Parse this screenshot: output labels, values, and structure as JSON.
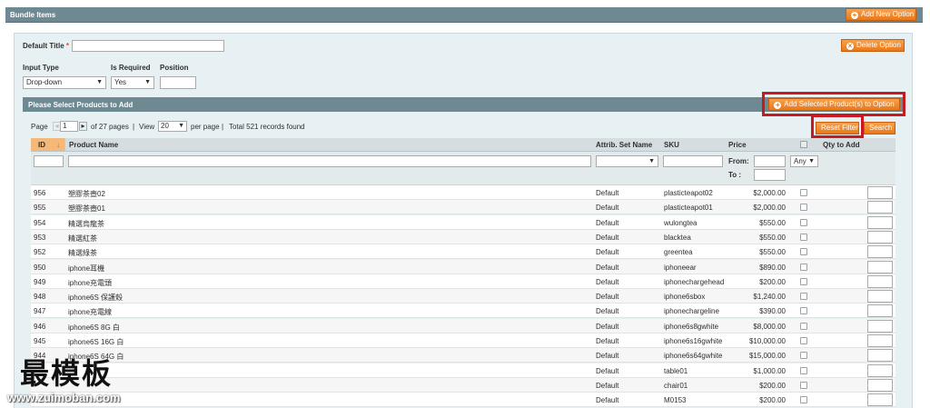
{
  "header": {
    "title": "Bundle Items",
    "add_new_option_label": "Add New Option"
  },
  "option": {
    "default_title_label": "Default Title",
    "required_mark": "*",
    "default_title_value": "",
    "delete_option_label": "Delete Option",
    "input_type_label": "Input Type",
    "input_type_value": "Drop-down",
    "is_required_label": "Is Required",
    "is_required_value": "Yes",
    "position_label": "Position",
    "position_value": ""
  },
  "grid": {
    "title": "Please Select Products to Add",
    "add_selected_label": "Add Selected Product(s) to Option",
    "reset_filter_label": "Reset Filter",
    "search_label": "Search",
    "pager": {
      "page_label": "Page",
      "page_value": "1",
      "of_pages": "of 27 pages",
      "separator": "|",
      "view_label": "View",
      "per_page_value": "20",
      "per_page_label": "per page",
      "total": "Total 521 records found"
    },
    "columns": {
      "id": "ID",
      "sort_arrow": "↓",
      "name": "Product Name",
      "attrib_set": "Attrib. Set Name",
      "sku": "SKU",
      "price": "Price",
      "qty": "Qty to Add"
    },
    "filters": {
      "price_from_label": "From:",
      "price_to_label": "To :",
      "select_any": "Any"
    },
    "rows": [
      {
        "id": "956",
        "name": "塑膠茶壺02",
        "set": "Default",
        "sku": "plasticteapot02",
        "price": "$2,000.00"
      },
      {
        "id": "955",
        "name": "塑膠茶壺01",
        "set": "Default",
        "sku": "plasticteapot01",
        "price": "$2,000.00"
      },
      {
        "id": "954",
        "name": "精選烏龍茶",
        "set": "Default",
        "sku": "wulongtea",
        "price": "$550.00"
      },
      {
        "id": "953",
        "name": "精選紅茶",
        "set": "Default",
        "sku": "blacktea",
        "price": "$550.00"
      },
      {
        "id": "952",
        "name": "精選綠茶",
        "set": "Default",
        "sku": "greentea",
        "price": "$550.00"
      },
      {
        "id": "950",
        "name": "iphone耳機",
        "set": "Default",
        "sku": "iphoneear",
        "price": "$890.00"
      },
      {
        "id": "949",
        "name": "iphone充電頭",
        "set": "Default",
        "sku": "iphonechargehead",
        "price": "$200.00"
      },
      {
        "id": "948",
        "name": "iphone6S 保護殼",
        "set": "Default",
        "sku": "iphone6sbox",
        "price": "$1,240.00"
      },
      {
        "id": "947",
        "name": "iphone充電線",
        "set": "Default",
        "sku": "iphonechargeline",
        "price": "$390.00"
      },
      {
        "id": "946",
        "name": "iphone6S 8G 白",
        "set": "Default",
        "sku": "iphone6s8gwhite",
        "price": "$8,000.00"
      },
      {
        "id": "945",
        "name": "iphone6S 16G 白",
        "set": "Default",
        "sku": "iphone6s16gwhite",
        "price": "$10,000.00"
      },
      {
        "id": "944",
        "name": "iphone6S 64G 白",
        "set": "Default",
        "sku": "iphone6s64gwhite",
        "price": "$15,000.00"
      },
      {
        "id": "",
        "name": "",
        "set": "Default",
        "sku": "table01",
        "price": "$1,000.00"
      },
      {
        "id": "",
        "name": "",
        "set": "Default",
        "sku": "chair01",
        "price": "$200.00"
      },
      {
        "id": "",
        "name": "",
        "set": "Default",
        "sku": "M0153",
        "price": "$200.00"
      }
    ]
  },
  "watermark": {
    "text": "最模板",
    "url": "www.zuimoban.com"
  },
  "colors": {
    "header_bar": "#6f8992",
    "panel_bg": "#e7f1f4",
    "button_orange": "#e8781a",
    "highlight_red": "#c61a23"
  },
  "icons": {
    "add": "plus-circle-icon",
    "delete": "x-circle-icon",
    "sort": "arrow-down-icon",
    "prev": "arrow-left-icon",
    "next": "arrow-right-icon",
    "dropdown": "triangle-down-icon",
    "checkbox": "checkbox-icon"
  }
}
